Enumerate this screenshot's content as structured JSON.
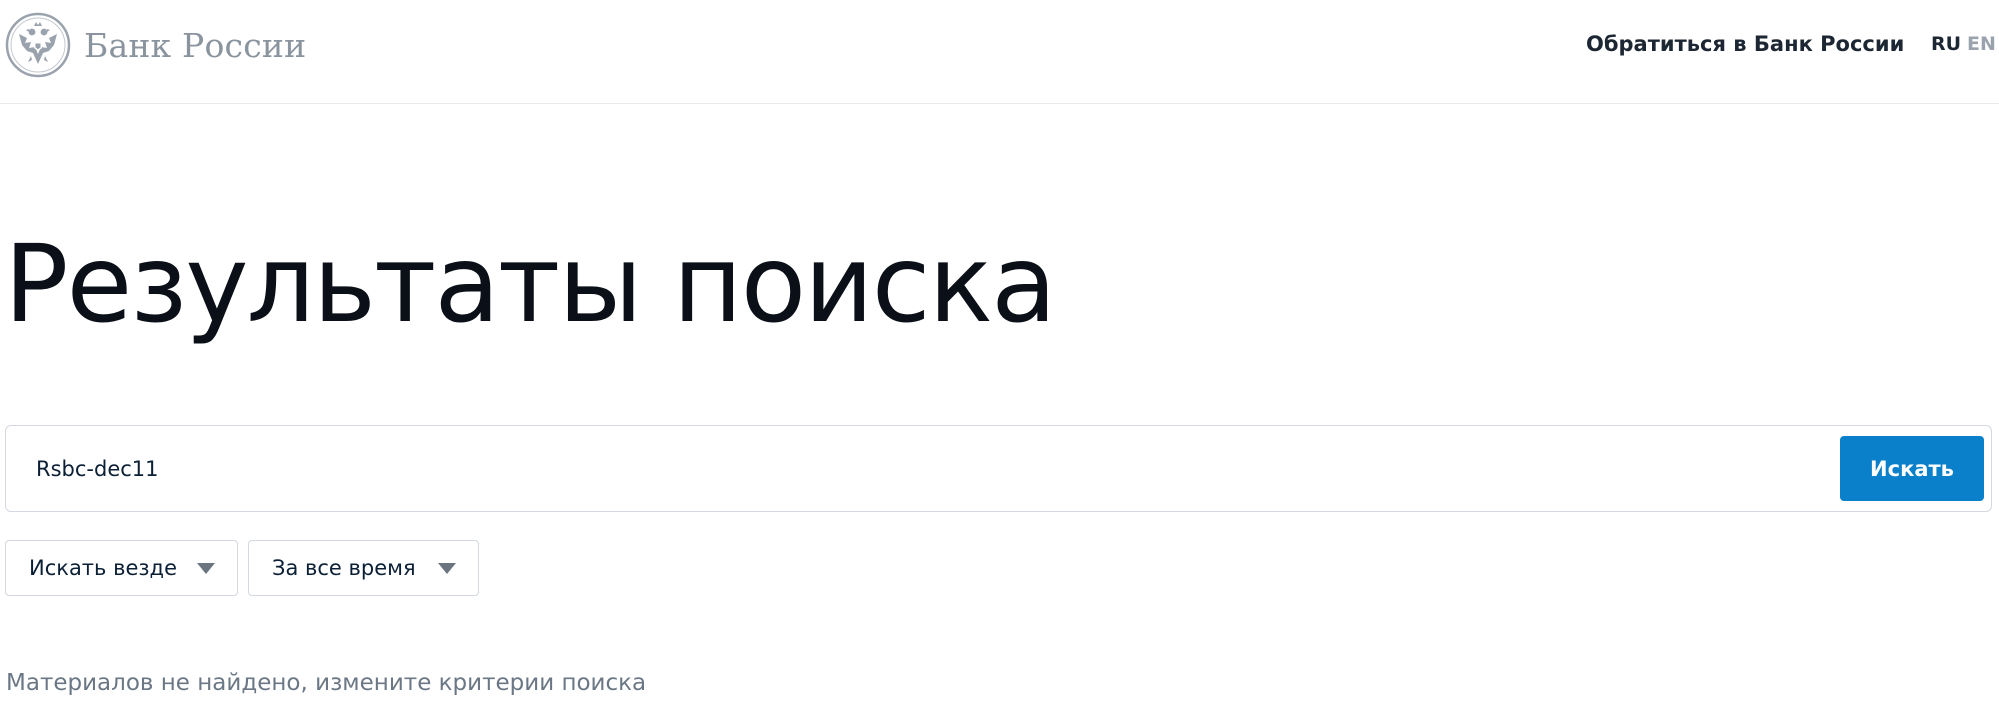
{
  "header": {
    "logo_text": "Банк России",
    "contact_link": "Обратиться в Банк России",
    "languages": [
      {
        "code": "RU",
        "active": true
      },
      {
        "code": "EN",
        "active": false
      }
    ]
  },
  "page": {
    "title": "Результаты поиска"
  },
  "search": {
    "value": "Rsbc-dec11",
    "button_label": "Искать"
  },
  "filters": {
    "where": {
      "selected": "Искать везде"
    },
    "when": {
      "selected": "За все время"
    }
  },
  "results": {
    "empty_message": "Материалов не найдено, измените критерии поиска"
  },
  "colors": {
    "accent": "#0a7fca",
    "muted_text": "#6b7785",
    "logo_gray": "#8a949e"
  }
}
